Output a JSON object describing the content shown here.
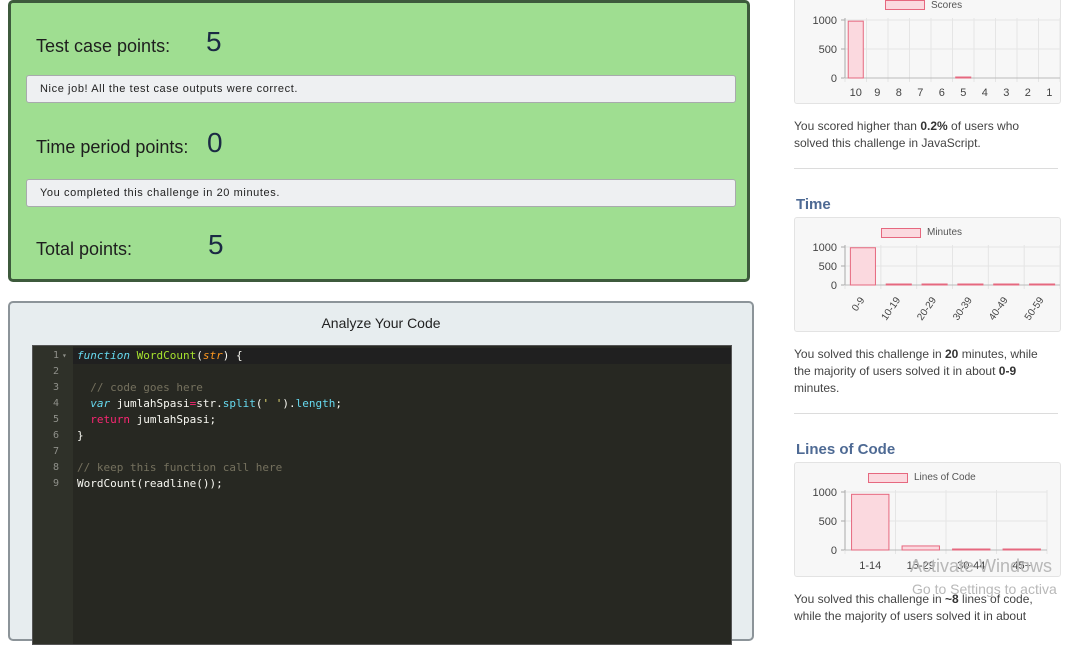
{
  "results": {
    "test_case_label": "Test case points:",
    "test_case_value": "5",
    "test_case_message": "Nice job! All the test case outputs were correct.",
    "time_label": "Time period points:",
    "time_value": "0",
    "time_message": "You completed this challenge in 20 minutes.",
    "total_label": "Total points:",
    "total_value": "5"
  },
  "analyze": {
    "title": "Analyze Your Code",
    "line_numbers": [
      "1",
      "2",
      "3",
      "4",
      "5",
      "6",
      "7",
      "8",
      "9"
    ]
  },
  "right": {
    "score_note_prefix": "You scored higher than ",
    "score_note_pct": "0.2%",
    "score_note_suffix": " of users who solved this challenge in JavaScript.",
    "time_title": "Time",
    "time_note_prefix": "You solved this challenge in ",
    "time_note_minutes": "20",
    "time_note_mid": " minutes, while the majority of users solved it in about ",
    "time_note_range": "0-9",
    "time_note_suffix": " minutes.",
    "loc_title": "Lines of Code",
    "loc_note_prefix": "You solved this challenge in ",
    "loc_note_lines": "~8",
    "loc_note_mid": " lines of code, while the majority of users solved it in about",
    "watermark_line1": "Activate Windows",
    "watermark_line2": "Go to Settings to activa"
  },
  "colors": {
    "bar_fill": "#fbd9df",
    "bar_stroke": "#e6687f",
    "results_bg": "#9fde91"
  },
  "chart_data": [
    {
      "type": "bar",
      "series": [
        {
          "name": "Scores",
          "values": [
            980,
            0,
            0,
            0,
            0,
            8,
            0,
            0,
            0,
            0
          ]
        }
      ],
      "categories": [
        "10",
        "9",
        "8",
        "7",
        "6",
        "5",
        "4",
        "3",
        "2",
        "1"
      ],
      "yticks": [
        "1000",
        "500",
        "0"
      ],
      "ylim": [
        0,
        1000
      ],
      "legend": "top"
    },
    {
      "type": "bar",
      "series": [
        {
          "name": "Minutes",
          "values": [
            980,
            3,
            2,
            1,
            1,
            1
          ]
        }
      ],
      "categories": [
        "0-9",
        "10-19",
        "20-29",
        "30-39",
        "40-49",
        "50-59"
      ],
      "yticks": [
        "1000",
        "500",
        "0"
      ],
      "ylim": [
        0,
        1000
      ],
      "legend": "top"
    },
    {
      "type": "bar",
      "series": [
        {
          "name": "Lines of Code",
          "values": [
            960,
            70,
            5,
            5
          ]
        }
      ],
      "categories": [
        "1-14",
        "15-29",
        "30-44",
        "45+"
      ],
      "yticks": [
        "1000",
        "500",
        "0"
      ],
      "ylim": [
        0,
        1000
      ],
      "legend": "top"
    }
  ]
}
